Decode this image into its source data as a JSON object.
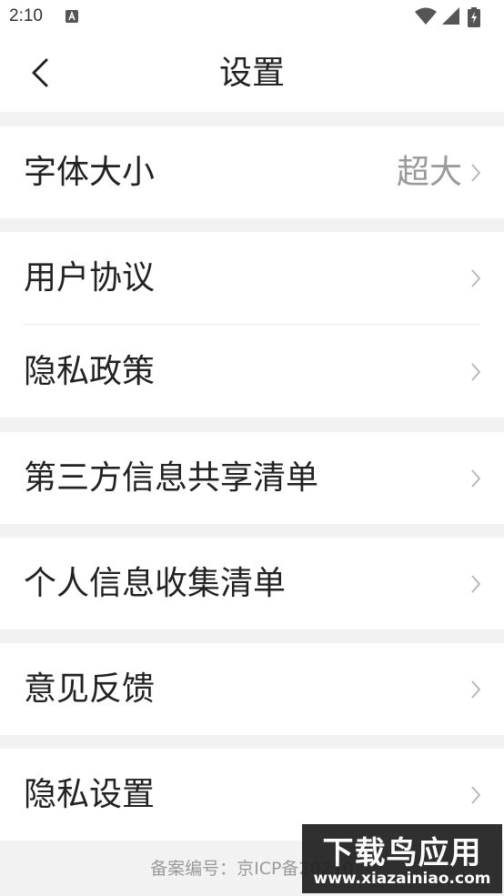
{
  "status_bar": {
    "time": "2:10"
  },
  "header": {
    "title": "设置"
  },
  "groups": [
    {
      "rows": [
        {
          "label": "字体大小",
          "value": "超大"
        }
      ]
    },
    {
      "rows": [
        {
          "label": "用户协议"
        },
        {
          "label": "隐私政策"
        }
      ]
    },
    {
      "rows": [
        {
          "label": "第三方信息共享清单"
        }
      ]
    },
    {
      "rows": [
        {
          "label": "个人信息收集清单"
        }
      ]
    },
    {
      "rows": [
        {
          "label": "意见反馈"
        }
      ]
    },
    {
      "rows": [
        {
          "label": "隐私设置"
        }
      ]
    }
  ],
  "footer": {
    "text": "备案编号：京ICP备20210"
  },
  "watermark": {
    "main": "下载鸟应用",
    "url": "www.xiazainiao.com"
  },
  "colors": {
    "background": "#f2f2f2",
    "card": "#ffffff",
    "muted_text": "#999999"
  }
}
